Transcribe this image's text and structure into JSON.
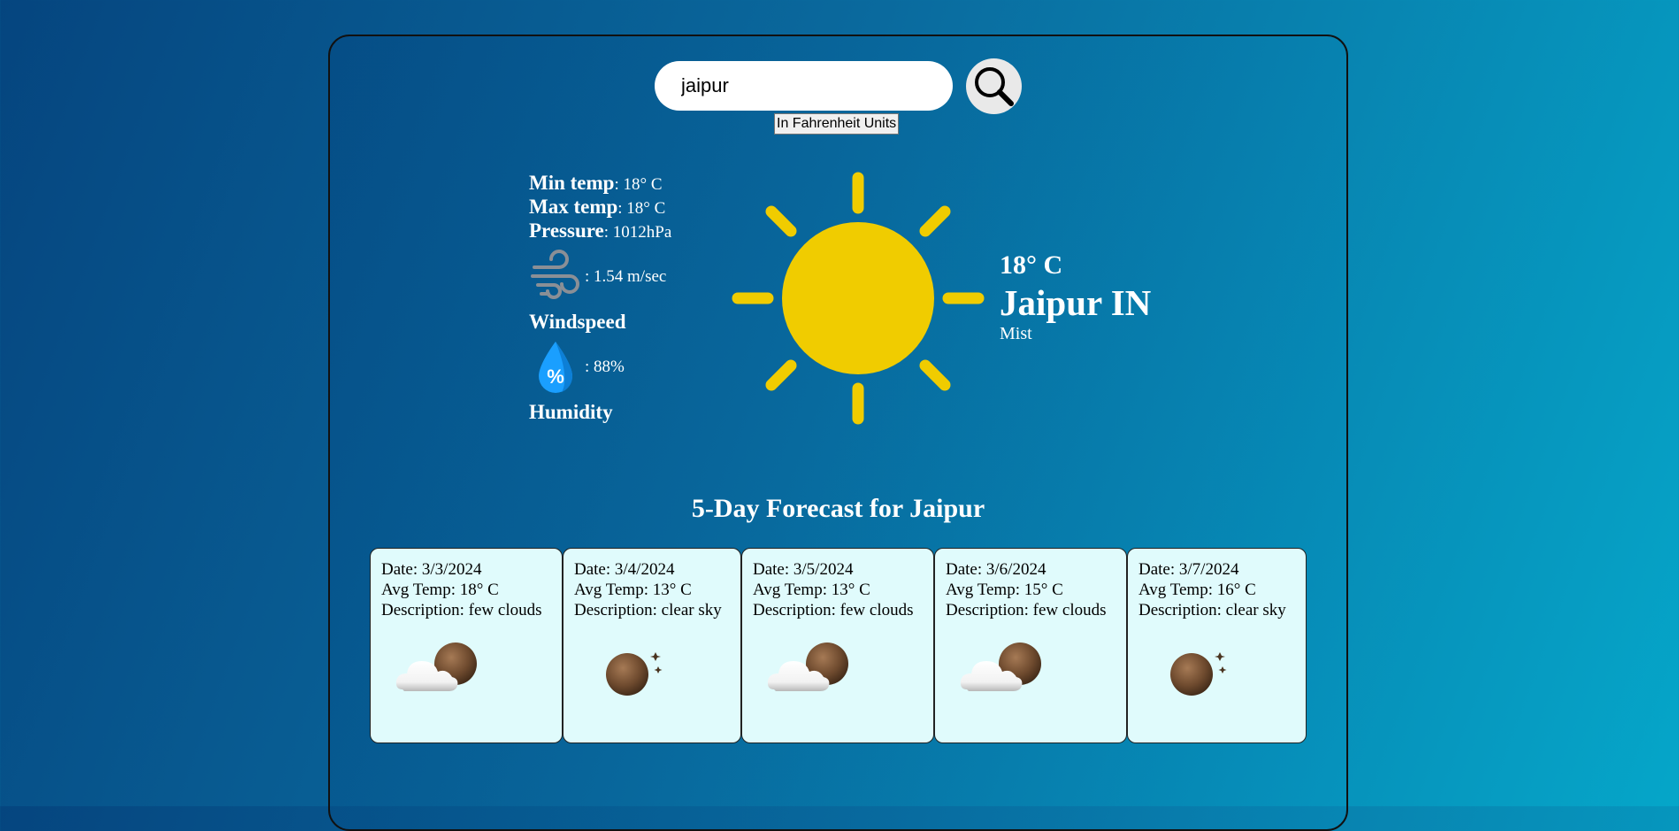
{
  "search": {
    "value": "jaipur",
    "placeholder": "",
    "unit_toggle_label": "In Fahrenheit Units"
  },
  "icons": {
    "search": "search-icon",
    "wind": "wind-icon",
    "humidity": "humidity-drop-icon",
    "weather": "sun-icon",
    "forecast_few_clouds": "cloud-moon-icon",
    "forecast_clear_sky": "moon-stars-icon"
  },
  "stats": {
    "min_temp_label": "Min temp",
    "min_temp_value": ": 18° C",
    "max_temp_label": "Max temp",
    "max_temp_value": ": 18° C",
    "pressure_label": "Pressure",
    "pressure_value": ": 1012hPa",
    "windspeed_value": ": 1.54 m/sec",
    "windspeed_label": "Windspeed",
    "humidity_value": ": 88%",
    "humidity_label": "Humidity",
    "humidity_icon_text": "%"
  },
  "current": {
    "temperature": "18° C",
    "city": "Jaipur IN",
    "description": "Mist"
  },
  "forecast": {
    "title": "5-Day Forecast for Jaipur",
    "days": [
      {
        "date": "Date: 3/3/2024",
        "avg_temp": "Avg Temp: 18° C",
        "description": "Description: few clouds",
        "icon": "cloud-moon-icon"
      },
      {
        "date": "Date: 3/4/2024",
        "avg_temp": "Avg Temp: 13° C",
        "description": "Description: clear sky",
        "icon": "moon-stars-icon"
      },
      {
        "date": "Date: 3/5/2024",
        "avg_temp": "Avg Temp: 13° C",
        "description": "Description: few clouds",
        "icon": "cloud-moon-icon"
      },
      {
        "date": "Date: 3/6/2024",
        "avg_temp": "Avg Temp: 15° C",
        "description": "Description: few clouds",
        "icon": "cloud-moon-icon"
      },
      {
        "date": "Date: 3/7/2024",
        "avg_temp": "Avg Temp: 16° C",
        "description": "Description: clear sky",
        "icon": "moon-stars-icon"
      }
    ]
  },
  "colors": {
    "background_start": "#05457f",
    "background_end": "#05a6c9",
    "sun": "#f0cc00",
    "forecast_card_bg": "#e0fbfc",
    "humidity_drop": "#1a9fff"
  }
}
